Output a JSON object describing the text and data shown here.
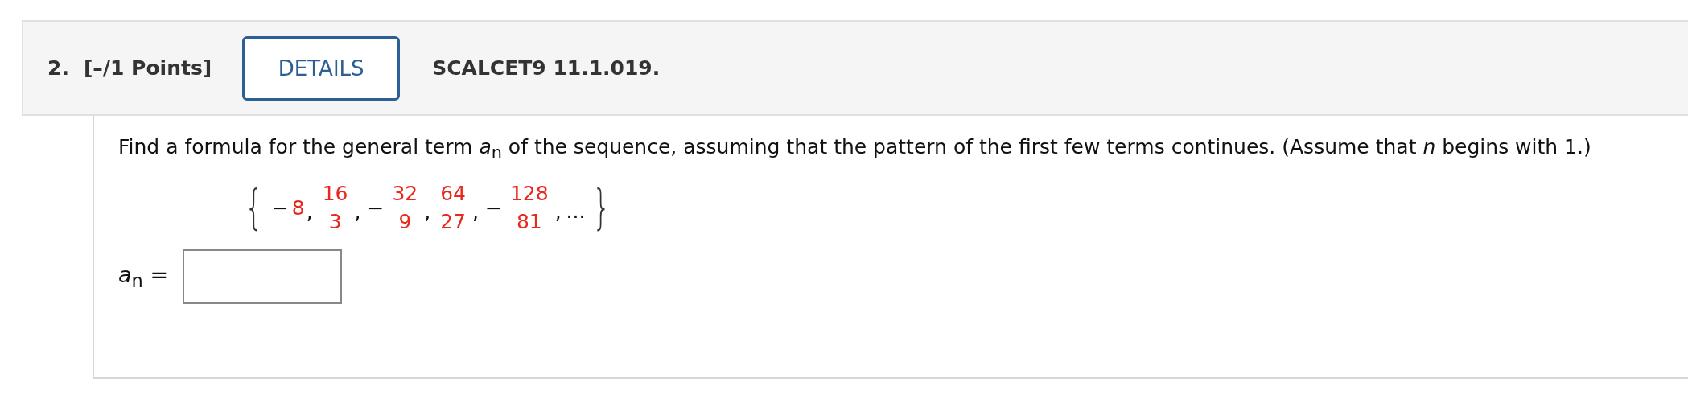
{
  "header": {
    "number": "2.",
    "points": "[–/1 Points]",
    "details_button": "DETAILS",
    "code": "SCALCET9 11.1.019."
  },
  "question": {
    "prompt": "Find a formula for the general term *a*$_{n}$ of the sequence, assuming that the pattern of the first few terms continues. (Assume that *n* begins with 1.)",
    "sequence": {
      "open": "{",
      "close": "}",
      "separator": ",",
      "ellipsis": "...",
      "terms": [
        {
          "kind": "integer",
          "sign": "−",
          "value": "8"
        },
        {
          "kind": "fraction",
          "numerator": "16",
          "denominator": "3"
        },
        {
          "kind": "fraction",
          "sign": "−",
          "numerator": "32",
          "denominator": "9"
        },
        {
          "kind": "fraction",
          "numerator": "64",
          "denominator": "27"
        },
        {
          "kind": "fraction",
          "sign": "−",
          "numerator": "128",
          "denominator": "81"
        }
      ]
    },
    "answer": {
      "label": "*a*$_{n}$ ="
    }
  }
}
